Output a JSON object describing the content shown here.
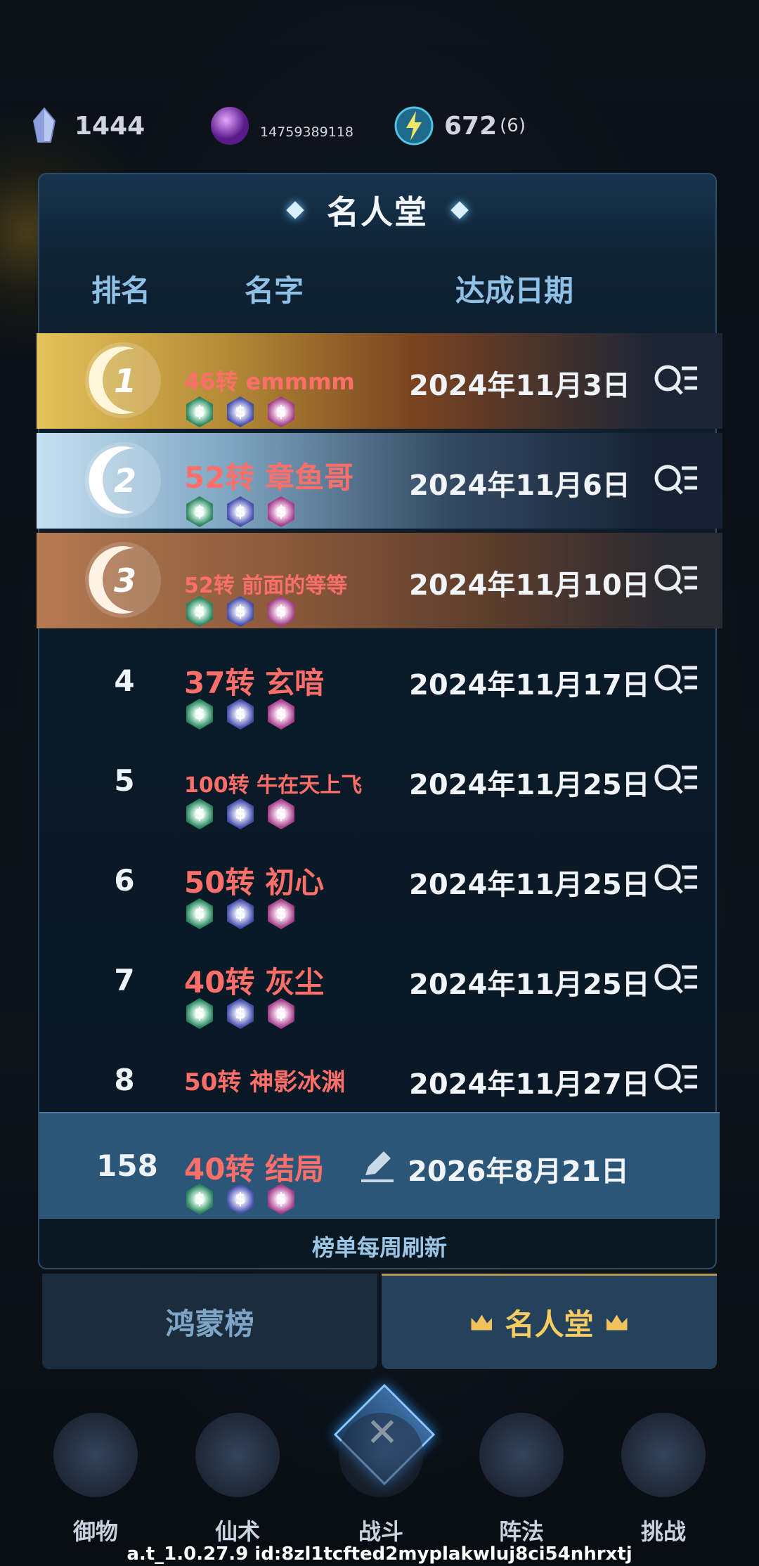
{
  "resources": [
    {
      "icon": "crystal-icon",
      "value": "1444"
    },
    {
      "icon": "purple-orb-icon",
      "value": "14759389118"
    },
    {
      "icon": "energy-icon",
      "value": "672",
      "sub": "(6)"
    }
  ],
  "dialog": {
    "title": "名人堂",
    "columns": {
      "rank": "排名",
      "name": "名字",
      "date": "达成日期"
    },
    "rows": [
      {
        "rank": "1",
        "name": "46转 emmmm",
        "date": "2024年11月3日",
        "style": "gold"
      },
      {
        "rank": "2",
        "name": "52转 章鱼哥",
        "date": "2024年11月6日",
        "style": "silver"
      },
      {
        "rank": "3",
        "name": "52转 前面的等等",
        "date": "2024年11月10日",
        "style": "bronze"
      },
      {
        "rank": "4",
        "name": "37转 玄喑",
        "date": "2024年11月17日"
      },
      {
        "rank": "5",
        "name": "100转 牛在天上飞",
        "date": "2024年11月25日"
      },
      {
        "rank": "6",
        "name": "50转 初心",
        "date": "2024年11月25日"
      },
      {
        "rank": "7",
        "name": "40转 灰尘",
        "date": "2024年11月25日"
      },
      {
        "rank": "8",
        "name": "50转 神影冰渊",
        "date": "2024年11月27日"
      }
    ],
    "self_row": {
      "rank": "158",
      "name": "40转 结局",
      "date": "2026年8月21日"
    },
    "refresh_note": "榜单每周刷新",
    "tabs": [
      {
        "label": "鸿蒙榜",
        "active": false
      },
      {
        "label": "名人堂",
        "active": true
      }
    ]
  },
  "bottom_nav": [
    "御物",
    "仙术",
    "战斗",
    "阵法",
    "挑战"
  ],
  "footer_id": "a.t_1.0.27.9 id:8zl1tcfted2myplakwluj8ci54nhrxtj",
  "colors": {
    "name_red": "#ff6f6a",
    "header_blue": "#8fc1e6",
    "gold": "#f6cc62"
  }
}
